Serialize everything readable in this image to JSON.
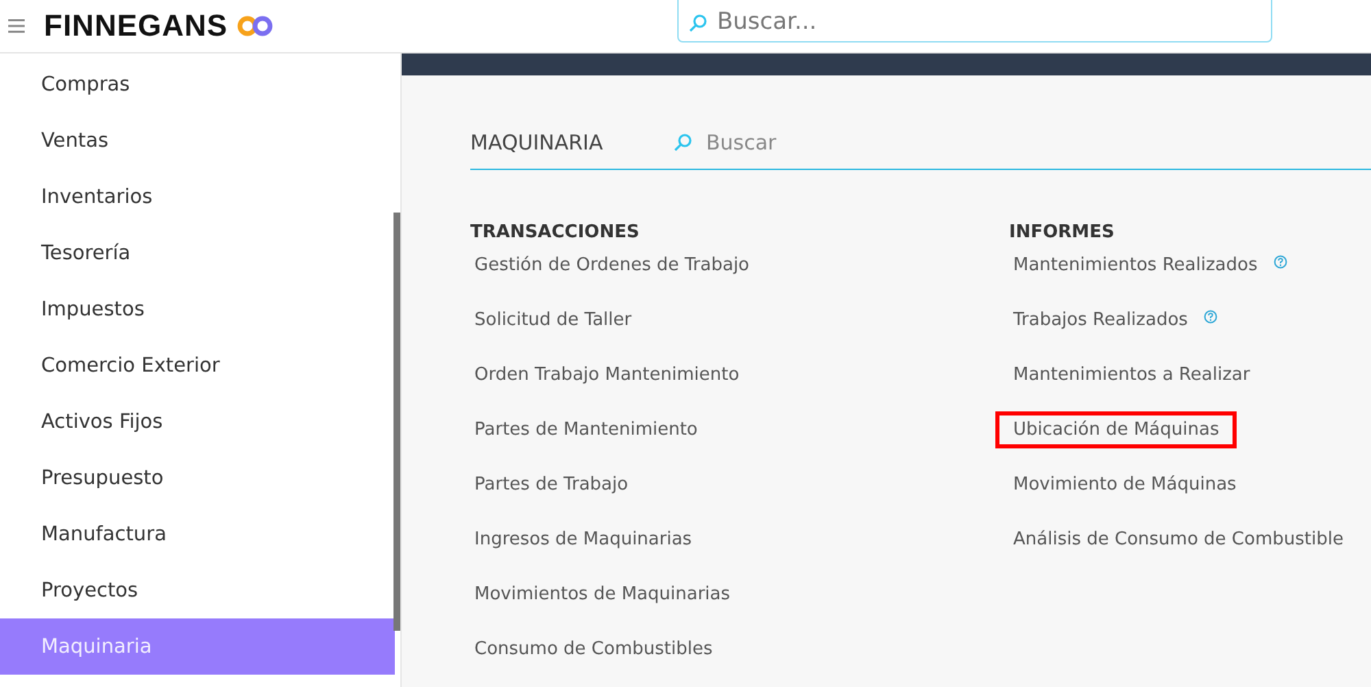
{
  "header": {
    "brand": "FINNEGANS",
    "search": {
      "placeholder": "Buscar..."
    }
  },
  "sidebar": {
    "items": [
      {
        "label": "Compras",
        "selected": false
      },
      {
        "label": "Ventas",
        "selected": false
      },
      {
        "label": "Inventarios",
        "selected": false
      },
      {
        "label": "Tesorería",
        "selected": false
      },
      {
        "label": "Impuestos",
        "selected": false
      },
      {
        "label": "Comercio Exterior",
        "selected": false
      },
      {
        "label": "Activos Fijos",
        "selected": false
      },
      {
        "label": "Presupuesto",
        "selected": false
      },
      {
        "label": "Manufactura",
        "selected": false
      },
      {
        "label": "Proyectos",
        "selected": false
      },
      {
        "label": "Maquinaria",
        "selected": true
      }
    ]
  },
  "module": {
    "title": "MAQUINARIA",
    "search": {
      "placeholder": "Buscar"
    },
    "sections": [
      {
        "heading": "TRANSACCIONES",
        "items": [
          {
            "label": "Gestión de Ordenes de Trabajo",
            "help": false,
            "highlighted": false
          },
          {
            "label": "Solicitud de Taller",
            "help": false,
            "highlighted": false
          },
          {
            "label": "Orden Trabajo Mantenimiento",
            "help": false,
            "highlighted": false
          },
          {
            "label": "Partes de Mantenimiento",
            "help": false,
            "highlighted": false
          },
          {
            "label": "Partes de Trabajo",
            "help": false,
            "highlighted": false
          },
          {
            "label": "Ingresos de Maquinarias",
            "help": false,
            "highlighted": false
          },
          {
            "label": "Movimientos de Maquinarias",
            "help": false,
            "highlighted": false
          },
          {
            "label": "Consumo de Combustibles",
            "help": false,
            "highlighted": false
          }
        ]
      },
      {
        "heading": "INFORMES",
        "items": [
          {
            "label": "Mantenimientos Realizados",
            "help": true,
            "highlighted": false
          },
          {
            "label": "Trabajos Realizados",
            "help": true,
            "highlighted": false
          },
          {
            "label": "Mantenimientos a Realizar",
            "help": false,
            "highlighted": false
          },
          {
            "label": "Ubicación de Máquinas",
            "help": false,
            "highlighted": true
          },
          {
            "label": "Movimiento de Máquinas",
            "help": false,
            "highlighted": false
          },
          {
            "label": "Análisis de Consumo de Combustible",
            "help": false,
            "highlighted": false
          }
        ]
      }
    ]
  }
}
